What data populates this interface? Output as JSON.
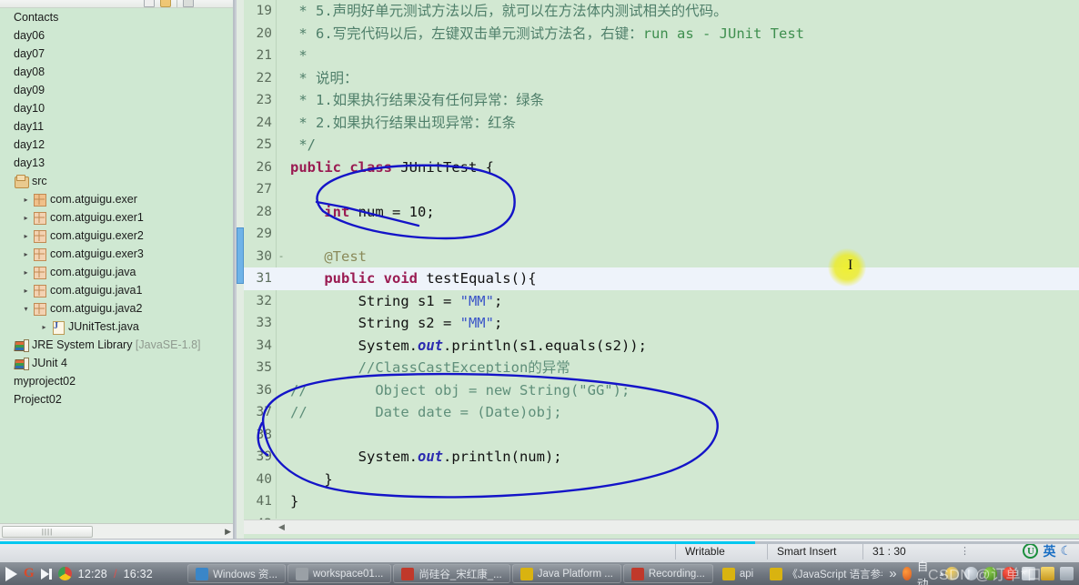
{
  "explorer": {
    "toolbar": [
      "collapse-all-icon",
      "link-with-editor-icon",
      "view-menu-icon"
    ],
    "items": [
      {
        "label": "Contacts",
        "icon": "none",
        "arrow": "none",
        "indent": 0
      },
      {
        "label": "day06",
        "icon": "none",
        "arrow": "none",
        "indent": 0
      },
      {
        "label": "day07",
        "icon": "none",
        "arrow": "none",
        "indent": 0
      },
      {
        "label": "day08",
        "icon": "none",
        "arrow": "none",
        "indent": 0
      },
      {
        "label": "day09",
        "icon": "none",
        "arrow": "none",
        "indent": 0
      },
      {
        "label": "day10",
        "icon": "none",
        "arrow": "none",
        "indent": 0
      },
      {
        "label": "day11",
        "icon": "none",
        "arrow": "none",
        "indent": 0
      },
      {
        "label": "day12",
        "icon": "none",
        "arrow": "none",
        "indent": 0
      },
      {
        "label": "day13",
        "icon": "none",
        "arrow": "none",
        "indent": 0
      },
      {
        "label": "src",
        "icon": "source-folder-icon",
        "arrow": "none",
        "indent": 0
      },
      {
        "label": "com.atguigu.exer",
        "icon": "package-icon",
        "arrow": "collapsed",
        "indent": 1
      },
      {
        "label": "com.atguigu.exer1",
        "icon": "package-icon",
        "arrow": "collapsed",
        "indent": 1
      },
      {
        "label": "com.atguigu.exer2",
        "icon": "package-icon",
        "arrow": "collapsed",
        "indent": 1
      },
      {
        "label": "com.atguigu.exer3",
        "icon": "package-icon",
        "arrow": "collapsed",
        "indent": 1
      },
      {
        "label": "com.atguigu.java",
        "icon": "package-icon",
        "arrow": "collapsed",
        "indent": 1
      },
      {
        "label": "com.atguigu.java1",
        "icon": "package-icon",
        "arrow": "collapsed",
        "indent": 1
      },
      {
        "label": "com.atguigu.java2",
        "icon": "package-icon",
        "arrow": "expanded",
        "indent": 1
      },
      {
        "label": "JUnitTest.java",
        "icon": "java-file-icon",
        "arrow": "collapsed",
        "indent": 2
      },
      {
        "label": "JRE System Library",
        "sub": "[JavaSE-1.8]",
        "icon": "library-icon",
        "arrow": "none",
        "indent": 0
      },
      {
        "label": "JUnit 4",
        "icon": "library-icon",
        "arrow": "none",
        "indent": 0
      },
      {
        "label": "myproject02",
        "icon": "none",
        "arrow": "none",
        "indent": 0
      },
      {
        "label": "Project02",
        "icon": "none",
        "arrow": "none",
        "indent": 0
      }
    ],
    "hscroll": {
      "grip": "||||",
      "right_arrow": "▶"
    }
  },
  "editor": {
    "lines": [
      {
        "n": "19",
        "fold": "",
        "active": false,
        "tokens": [
          {
            "t": " * ",
            "c": "cmt"
          },
          {
            "t": "5.",
            "c": "cmt"
          },
          {
            "t": "声明好单元测试方法以后，就可以在方法体内测试相关的代码。",
            "c": "cmt"
          }
        ]
      },
      {
        "n": "20",
        "fold": "",
        "active": false,
        "tokens": [
          {
            "t": " * ",
            "c": "cmt"
          },
          {
            "t": "6.",
            "c": "cmt"
          },
          {
            "t": "写完代码以后，左键双击单元测试方法名，右键：",
            "c": "cmt"
          },
          {
            "t": "run as - JUnit Test",
            "c": "run"
          }
        ]
      },
      {
        "n": "21",
        "fold": "",
        "active": false,
        "tokens": [
          {
            "t": " * ",
            "c": "cmt"
          }
        ]
      },
      {
        "n": "22",
        "fold": "",
        "active": false,
        "tokens": [
          {
            "t": " * ",
            "c": "cmt"
          },
          {
            "t": "说明：",
            "c": "cmt"
          }
        ]
      },
      {
        "n": "23",
        "fold": "",
        "active": false,
        "tokens": [
          {
            "t": " * ",
            "c": "cmt"
          },
          {
            "t": "1.",
            "c": "cmt"
          },
          {
            "t": "如果执行结果没有任何异常：绿条",
            "c": "cmt"
          }
        ]
      },
      {
        "n": "24",
        "fold": "",
        "active": false,
        "tokens": [
          {
            "t": " * ",
            "c": "cmt"
          },
          {
            "t": "2.",
            "c": "cmt"
          },
          {
            "t": "如果执行结果出现异常：红条",
            "c": "cmt"
          }
        ]
      },
      {
        "n": "25",
        "fold": "",
        "active": false,
        "tokens": [
          {
            "t": " */",
            "c": "cmt"
          }
        ]
      },
      {
        "n": "26",
        "fold": "",
        "active": false,
        "tokens": [
          {
            "t": "public class ",
            "c": "kw"
          },
          {
            "t": "JUnitTest ",
            "c": "plain"
          },
          {
            "t": "{",
            "c": "plain"
          }
        ]
      },
      {
        "n": "27",
        "fold": "",
        "active": false,
        "tokens": []
      },
      {
        "n": "28",
        "fold": "",
        "active": false,
        "tokens": [
          {
            "t": "    ",
            "c": "plain"
          },
          {
            "t": "int",
            "c": "kw"
          },
          {
            "t": " num = ",
            "c": "plain"
          },
          {
            "t": "10",
            "c": "plain"
          },
          {
            "t": ";",
            "c": "plain"
          }
        ]
      },
      {
        "n": "29",
        "fold": "",
        "active": false,
        "tokens": []
      },
      {
        "n": "30",
        "fold": "-",
        "active": false,
        "tokens": [
          {
            "t": "    ",
            "c": "plain"
          },
          {
            "t": "@Test",
            "c": "ann"
          }
        ]
      },
      {
        "n": "31",
        "fold": "",
        "active": true,
        "tokens": [
          {
            "t": "    ",
            "c": "plain"
          },
          {
            "t": "public void ",
            "c": "kw"
          },
          {
            "t": "testEquals",
            "c": "plain"
          },
          {
            "t": "(){",
            "c": "plain"
          }
        ]
      },
      {
        "n": "32",
        "fold": "",
        "active": false,
        "tokens": [
          {
            "t": "        String s1 = ",
            "c": "plain"
          },
          {
            "t": "\"MM\"",
            "c": "str"
          },
          {
            "t": ";",
            "c": "plain"
          }
        ]
      },
      {
        "n": "33",
        "fold": "",
        "active": false,
        "tokens": [
          {
            "t": "        String s2 = ",
            "c": "plain"
          },
          {
            "t": "\"MM\"",
            "c": "str"
          },
          {
            "t": ";",
            "c": "plain"
          }
        ]
      },
      {
        "n": "34",
        "fold": "",
        "active": false,
        "tokens": [
          {
            "t": "        System.",
            "c": "plain"
          },
          {
            "t": "out",
            "c": "field"
          },
          {
            "t": ".println(s1.equals(s2));",
            "c": "plain"
          }
        ]
      },
      {
        "n": "35",
        "fold": "",
        "active": false,
        "tokens": [
          {
            "t": "        //ClassCastException的异常",
            "c": "cmt2"
          }
        ]
      },
      {
        "n": "36",
        "fold": "",
        "active": false,
        "prefix": "//",
        "tokens": [
          {
            "t": "        Object obj = ",
            "c": "cmt2"
          },
          {
            "t": "new",
            "c": "cmt2"
          },
          {
            "t": " String(\"GG\");",
            "c": "cmt2"
          }
        ]
      },
      {
        "n": "37",
        "fold": "",
        "active": false,
        "prefix": "//",
        "tokens": [
          {
            "t": "        Date date = (Date)obj;",
            "c": "cmt2"
          }
        ]
      },
      {
        "n": "38",
        "fold": "",
        "active": false,
        "tokens": []
      },
      {
        "n": "39",
        "fold": "",
        "active": false,
        "tokens": [
          {
            "t": "        System.",
            "c": "plain"
          },
          {
            "t": "out",
            "c": "field"
          },
          {
            "t": ".println(num);",
            "c": "plain"
          }
        ]
      },
      {
        "n": "40",
        "fold": "",
        "active": false,
        "tokens": [
          {
            "t": "    }",
            "c": "plain"
          }
        ]
      },
      {
        "n": "41",
        "fold": "",
        "active": false,
        "tokens": [
          {
            "t": "}",
            "c": "plain"
          }
        ]
      },
      {
        "n": "42",
        "fold": "",
        "active": false,
        "tokens": []
      }
    ],
    "hscroll_arrow": "◀"
  },
  "statusbar": {
    "writable": "Writable",
    "insert_mode": "Smart Insert",
    "position": "31 : 30",
    "dots": "⋮",
    "ime": {
      "logo": "U",
      "lang": "英",
      "moon": "☾"
    }
  },
  "video": {
    "elapsed": "12:28",
    "separator": "/",
    "total": "16:32",
    "play_icon": "play-icon",
    "next_icon": "next-icon"
  },
  "taskbar": {
    "buttons": [
      {
        "label": "Windows 资...",
        "icon_color": "#3a86c8",
        "icon": "explorer-icon"
      },
      {
        "label": "workspace01...",
        "icon_color": "#9aa0a6",
        "icon": "eclipse-icon"
      },
      {
        "label": "尚硅谷_宋红康_...",
        "icon_color": "#c0392b",
        "icon": "powerpoint-icon"
      },
      {
        "label": "Java Platform ...",
        "icon_color": "#d9b310",
        "icon": "java-help-icon"
      },
      {
        "label": "Recording...",
        "icon_color": "#c0392b",
        "icon": "recorder-icon"
      },
      {
        "label": "api",
        "icon_color": "#d9b310",
        "icon": "java-help-icon"
      },
      {
        "label": "《JavaScript 语言参考",
        "icon_color": "#d9b310",
        "icon": "chm-icon"
      }
    ],
    "overflow": "»",
    "tray_label": "自动",
    "tray_arrow": "▲"
  },
  "watermark": {
    "text": "CSDN @订单*口"
  }
}
